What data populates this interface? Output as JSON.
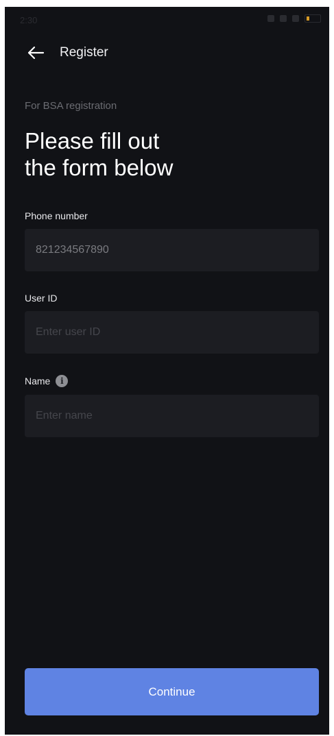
{
  "status_bar": {
    "time": "2:30",
    "battery_color": "#d69a26"
  },
  "header": {
    "back_icon": "arrow-left-icon",
    "title": "Register"
  },
  "form": {
    "subtitle": "For BSA registration",
    "heading_line1": "Please fill out",
    "heading_line2": "the form below",
    "phone": {
      "label": "Phone number",
      "value": "821234567890"
    },
    "user_id": {
      "label": "User ID",
      "placeholder": "Enter user ID"
    },
    "name": {
      "label": "Name",
      "info_icon": "info-icon",
      "info_glyph": "i",
      "placeholder": "Enter name"
    }
  },
  "footer": {
    "continue_label": "Continue",
    "accent_color": "#5f83e3"
  }
}
